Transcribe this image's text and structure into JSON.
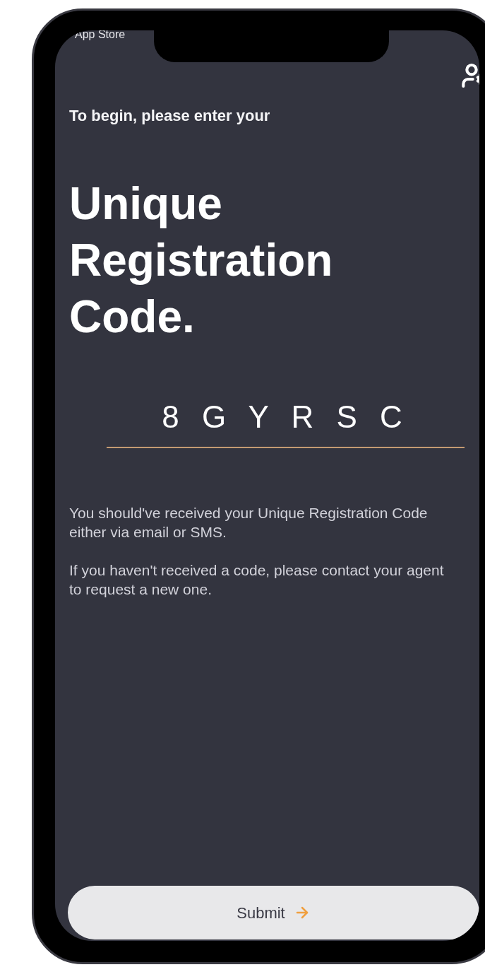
{
  "status_bar": {
    "back_label": "App Store"
  },
  "header": {
    "intro": "To begin, please enter your",
    "title": "Unique Registration Code."
  },
  "code_field": {
    "value": "8 G Y R S C"
  },
  "help_paragraphs": [
    "You should've received your Unique Registration Code either via email or SMS.",
    "If you haven't received a code, please contact your agent to request a new one."
  ],
  "submit_button": {
    "label": "Submit"
  }
}
